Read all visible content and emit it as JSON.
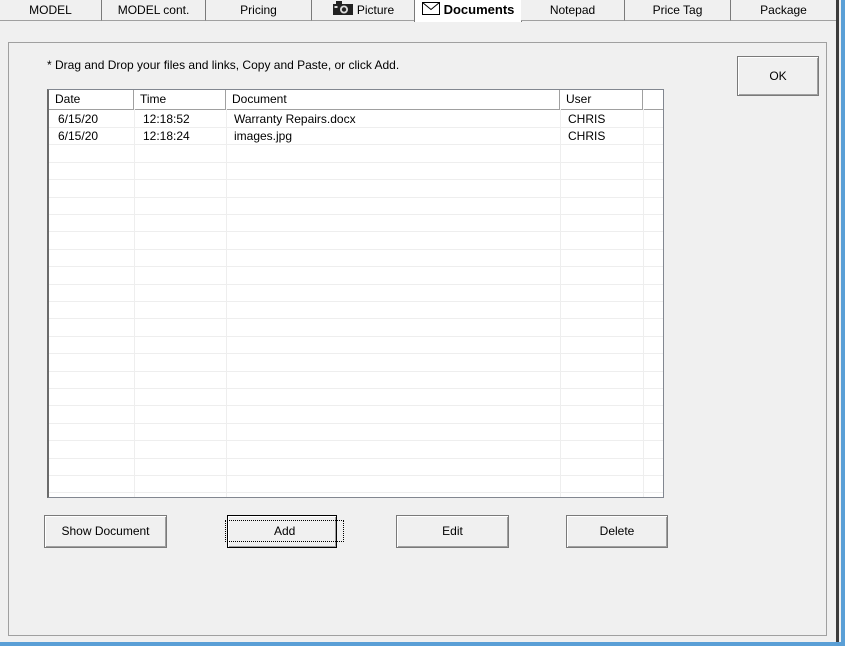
{
  "tabs": [
    {
      "label": "MODEL"
    },
    {
      "label": "MODEL cont."
    },
    {
      "label": "Pricing"
    },
    {
      "label": "Picture"
    },
    {
      "label": "Documents"
    },
    {
      "label": "Notepad"
    },
    {
      "label": "Price Tag"
    },
    {
      "label": "Package"
    }
  ],
  "hint": "* Drag and Drop your files and links, Copy and Paste, or click Add.",
  "ok_label": "OK",
  "list": {
    "columns": [
      "Date",
      "Time",
      "Document",
      "User"
    ],
    "rows": [
      {
        "date": "6/15/20",
        "time": "12:18:52",
        "document": "Warranty Repairs.docx",
        "user": "CHRIS"
      },
      {
        "date": "6/15/20",
        "time": "12:18:24",
        "document": "images.jpg",
        "user": "CHRIS"
      }
    ]
  },
  "buttons": {
    "show_document": "Show Document",
    "add": "Add",
    "edit": "Edit",
    "delete": "Delete"
  }
}
